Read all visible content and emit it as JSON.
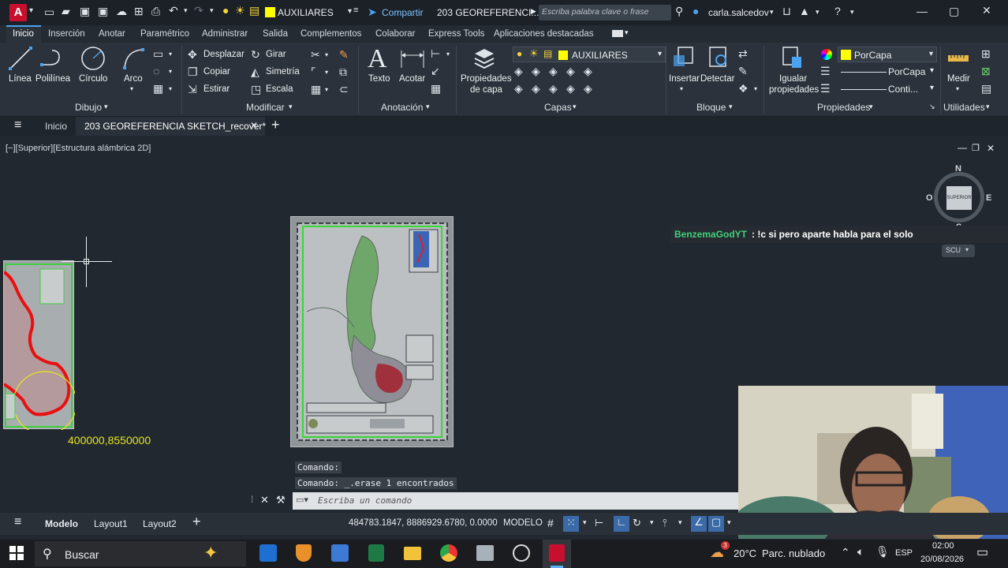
{
  "titlebar": {
    "app_letter": "A",
    "layer_name": "AUXILIARES",
    "share": "Compartir",
    "doc_title": "203 GEOREFERENCI...",
    "search_placeholder": "Escriba palabra clave o frase",
    "user": "carla.salcedov"
  },
  "ribbon_tabs": [
    "Inicio",
    "Inserción",
    "Anotar",
    "Paramétrico",
    "Administrar",
    "Salida",
    "Complementos",
    "Colaborar",
    "Express Tools",
    "Aplicaciones destacadas"
  ],
  "draw": {
    "line": "Línea",
    "polyline": "Polilínea",
    "circle": "Círculo",
    "arc": "Arco",
    "panel": "Dibujo"
  },
  "modify": {
    "move": "Desplazar",
    "rotate": "Girar",
    "copy": "Copiar",
    "mirror": "Simetría",
    "stretch": "Estirar",
    "scale": "Escala",
    "panel": "Modificar"
  },
  "annotation": {
    "text": "Texto",
    "dimension": "Acotar",
    "panel": "Anotación"
  },
  "layers": {
    "props_line1": "Propiedades",
    "props_line2": "de capa",
    "current": "AUXILIARES",
    "panel": "Capas"
  },
  "block": {
    "insert": "Insertar",
    "detect": "Detectar",
    "panel": "Bloque"
  },
  "properties": {
    "match_line1": "Igualar",
    "match_line2": "propiedades",
    "color": "PorCapa",
    "lineweight": "PorCapa",
    "linetype": "Conti...",
    "panel": "Propiedades"
  },
  "utilities": {
    "measure": "Medir",
    "panel": "Utilidades"
  },
  "doc_tabs": {
    "start": "Inicio",
    "active": "203 GEOREFERENCIA SKETCH_recover*"
  },
  "viewport": {
    "label": "[−][Superior][Estructura alámbrica 2D]",
    "coord_label": "400000,8550000",
    "viewcube": {
      "n": "N",
      "s": "S",
      "e": "E",
      "w": "O",
      "face": "SUPERIOR",
      "ucs": "SCU"
    }
  },
  "chat": {
    "user": "BenzemaGodYT",
    "message": ": !c si pero aparte habla para el solo"
  },
  "command": {
    "line1": "Comando:",
    "line2": "Comando: _.erase 1 encontrados",
    "placeholder": "Escriba un comando"
  },
  "status": {
    "model_tab": "Modelo",
    "layout1": "Layout1",
    "layout2": "Layout2",
    "coords": "484783.1847, 8886929.6780, 0.0000",
    "model": "MODELO"
  },
  "taskbar": {
    "search": "Buscar",
    "weather_temp": "20°C",
    "weather_desc": "Parc. nublado",
    "lang": "ESP",
    "time": "02:00",
    "date": "20/08/2026",
    "notif": "3"
  }
}
